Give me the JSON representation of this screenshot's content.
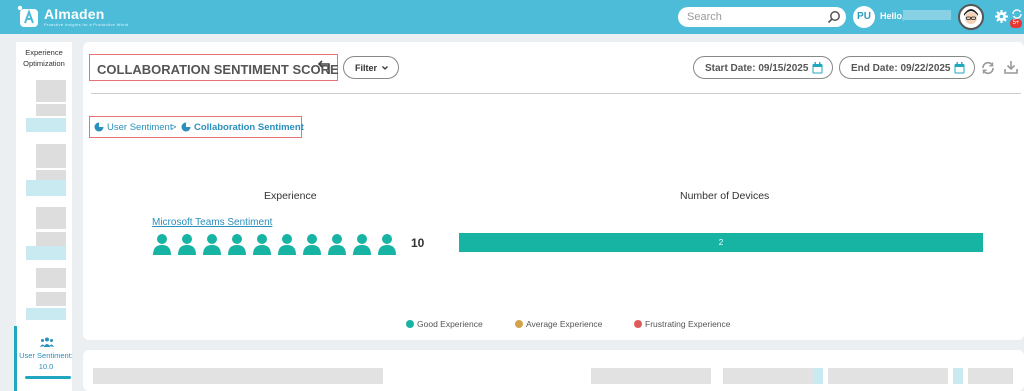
{
  "app": {
    "brand": "Almaden",
    "brand_tagline": "Proactive Insights for a Productive World",
    "search_placeholder": "Search",
    "user_initials": "PU",
    "greeting": "Hello,",
    "notification_badge": "5+",
    "accent_color": "#4dbcd9"
  },
  "sidebar": {
    "title": "Experience Optimization",
    "active_item": {
      "label": "User Sentiment: 10.0",
      "icon": "users-icon"
    }
  },
  "header": {
    "title": "COLLABORATION SENTIMENT SCORE",
    "filter_label": "Filter",
    "start_date_label": "Start Date: 09/15/2025",
    "end_date_label": "End Date: 09/22/2025"
  },
  "breadcrumb": {
    "parent": "User Sentiment",
    "separator": ">",
    "current": "Collaboration Sentiment"
  },
  "table": {
    "experience_header": "Experience",
    "devices_header": "Number of Devices",
    "rows": [
      {
        "name": "Microsoft Teams Sentiment",
        "user_icons": 10,
        "count": "10",
        "devices_value": 2,
        "devices_label": "2",
        "devices_fraction": 1.0
      }
    ]
  },
  "legend": [
    {
      "label": "Good Experience",
      "color": "#17b3a3"
    },
    {
      "label": "Average Experience",
      "color": "#d4a24c"
    },
    {
      "label": "Frustrating Experience",
      "color": "#e05a5a"
    }
  ]
}
